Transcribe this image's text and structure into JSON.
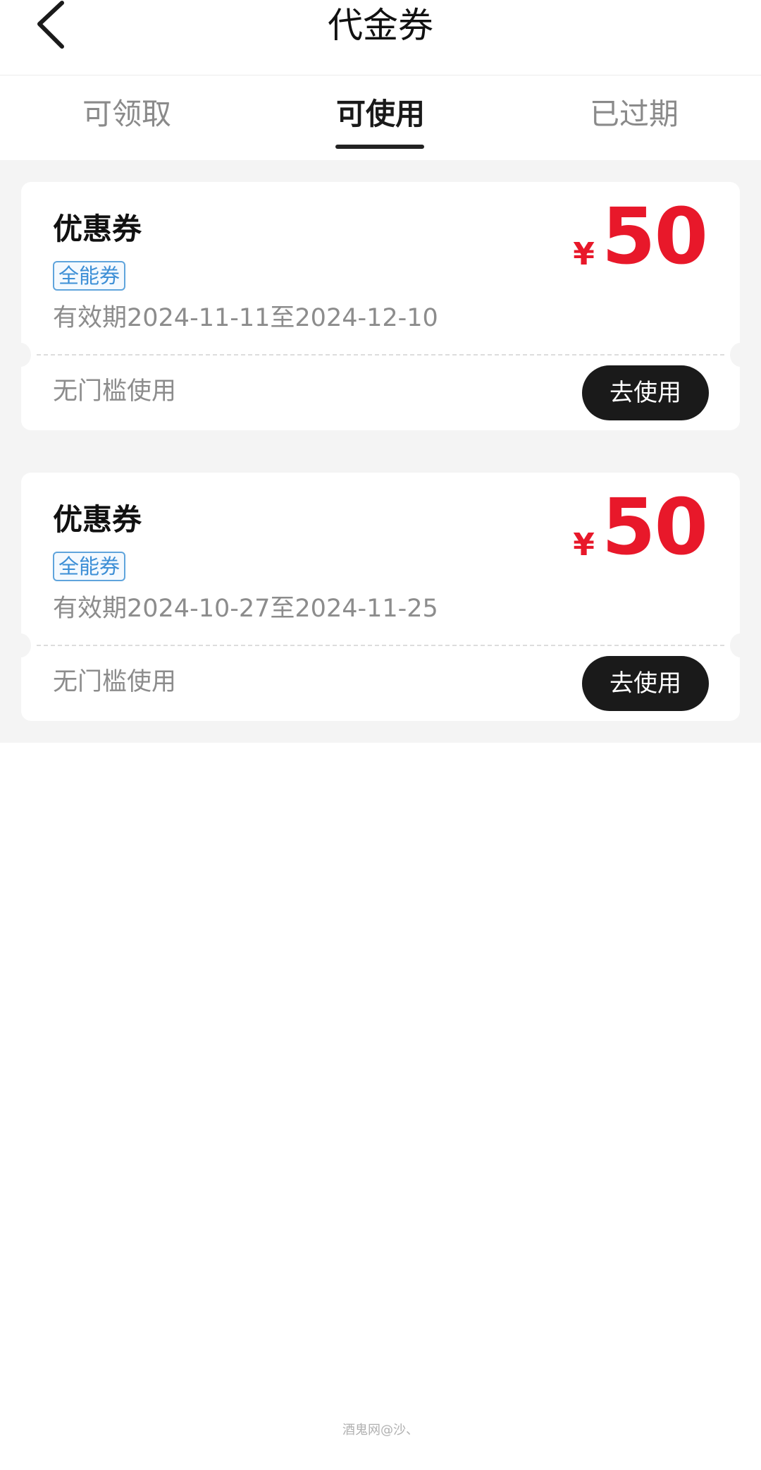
{
  "header": {
    "title": "代金券",
    "back_icon": "chevron-left-icon"
  },
  "tabs": [
    {
      "label": "可领取",
      "active": false
    },
    {
      "label": "可使用",
      "active": true
    },
    {
      "label": "已过期",
      "active": false
    }
  ],
  "coupons": [
    {
      "name": "优惠券",
      "tag": "全能券",
      "validity": "有效期2024-11-11至2024-12-10",
      "currency": "¥",
      "amount": "50",
      "condition": "无门槛使用",
      "button_label": "去使用"
    },
    {
      "name": "优惠券",
      "tag": "全能券",
      "validity": "有效期2024-10-27至2024-11-25",
      "currency": "¥",
      "amount": "50",
      "condition": "无门槛使用",
      "button_label": "去使用"
    }
  ],
  "watermark": "酒鬼网@沙、",
  "colors": {
    "price_red": "#e8182a",
    "tag_blue": "#3d8fd6",
    "button_dark": "#1a1a1a",
    "list_background": "#f4f4f4"
  }
}
